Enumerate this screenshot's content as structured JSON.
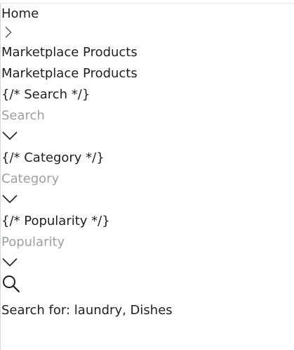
{
  "breadcrumb": {
    "home_label": "Home",
    "separator_icon": "chevron-right-icon",
    "current_label": "Marketplace Products"
  },
  "page": {
    "title": "Marketplace Products"
  },
  "filters": {
    "search_comment": "{/* Search */}",
    "search_placeholder": "Search",
    "category_comment": "{/* Category */}",
    "category_placeholder": "Category",
    "popularity_comment": "{/* Popularity */}",
    "popularity_placeholder": "Popularity",
    "dropdown_icon": "chevron-down-icon"
  },
  "search_action": {
    "icon": "search-icon"
  },
  "suggestion": {
    "text": "Search for: laundry, Dishes"
  }
}
